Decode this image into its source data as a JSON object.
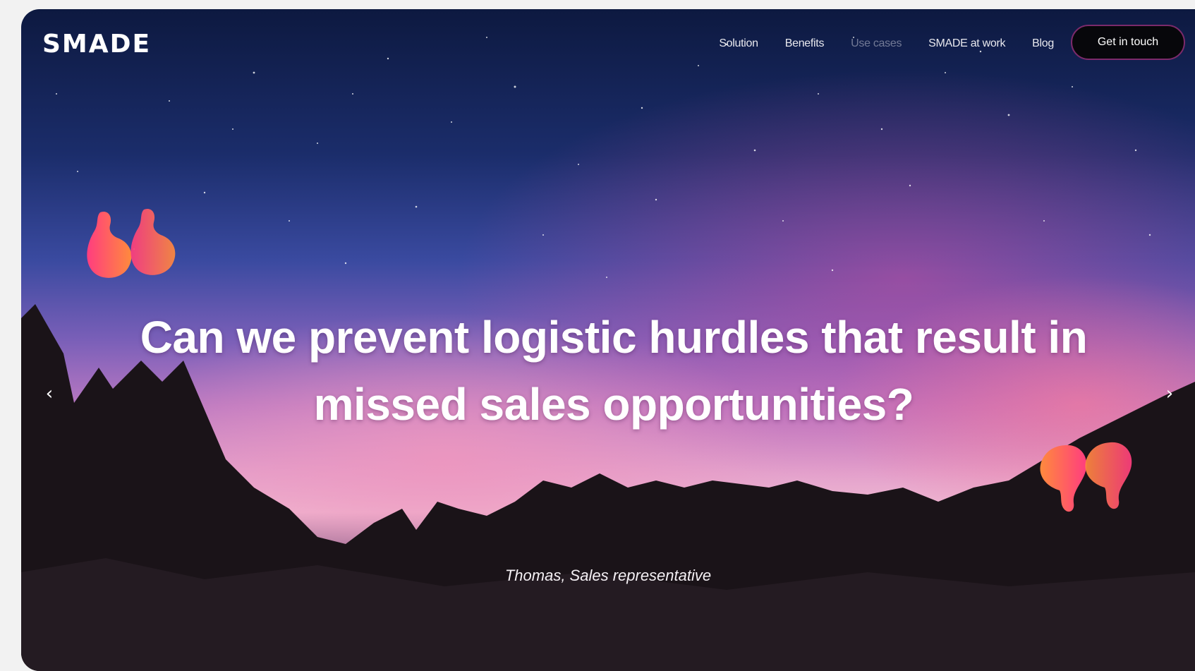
{
  "brand": {
    "logo_text": "SMADE"
  },
  "nav": {
    "links": [
      "Solution",
      "Benefits",
      "Use cases",
      "SMADE at work",
      "Blog"
    ],
    "cta_label": "Get in touch"
  },
  "hero": {
    "headline_line1": "Can we prevent logistic hurdles that result in",
    "headline_line2": "missed sales opportunities?",
    "attribution": "Thomas, Sales representative",
    "prev_arrow": "‹",
    "next_arrow": "›"
  },
  "colors": {
    "quote_gradient_start": "#ff3d7f",
    "quote_gradient_end": "#ff8a3d",
    "cta_border": "#7c2a6b",
    "cta_background": "#07070b"
  },
  "icons": {
    "open_quote": "quote-open-icon",
    "close_quote": "quote-close-icon",
    "prev": "chevron-left-icon",
    "next": "chevron-right-icon"
  }
}
